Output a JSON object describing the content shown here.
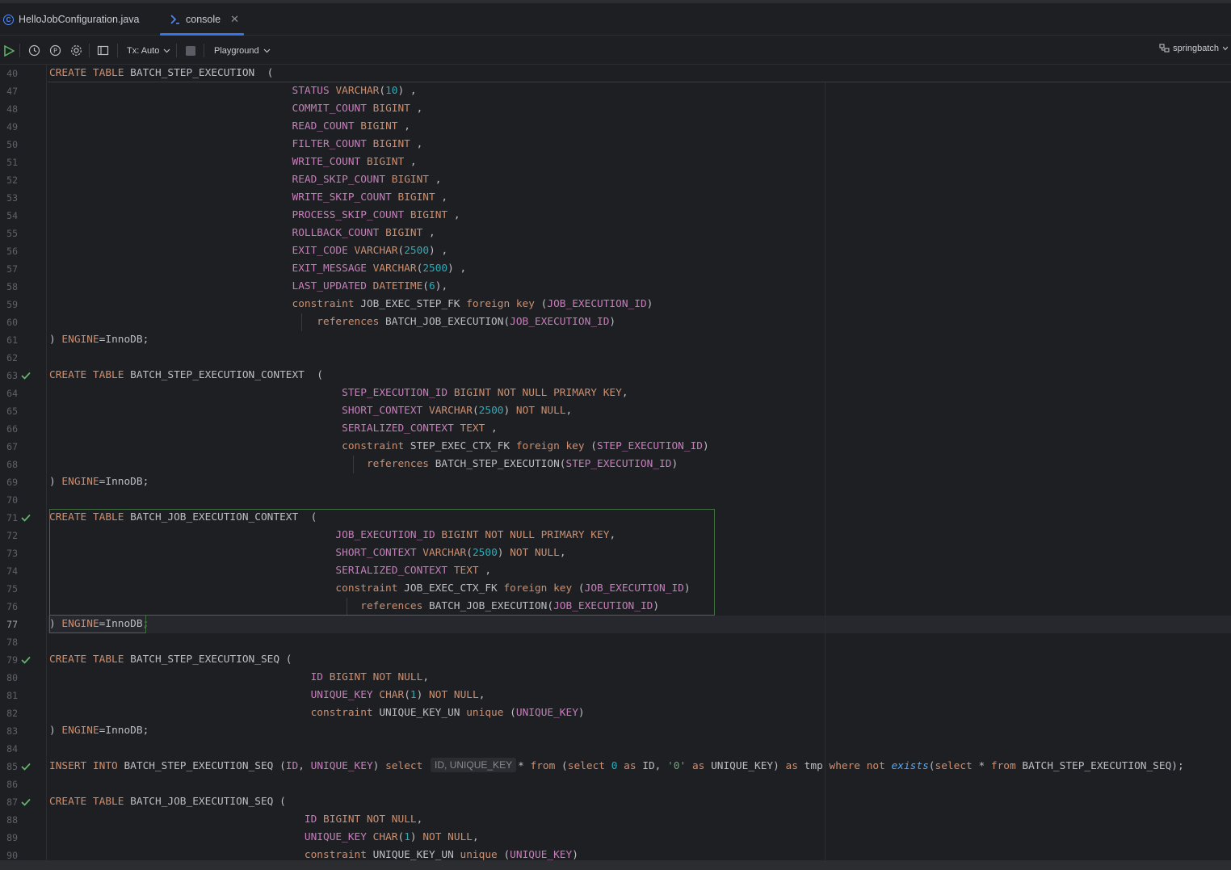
{
  "tabs": [
    {
      "label": "HelloJobConfiguration.java",
      "icon": "class-icon"
    },
    {
      "label": "console",
      "icon": "console-icon",
      "active": true
    }
  ],
  "toolbar": {
    "tx_label": "Tx: Auto",
    "playground_label": "Playground",
    "datasource_label": "springbatch"
  },
  "colors": {
    "keyword": "#cf8e6d",
    "column": "#c77dbb",
    "number": "#2aacb8",
    "string": "#6aab73",
    "function": "#56a8f5",
    "accent": "#3574f0",
    "check": "#5fb865"
  },
  "sticky_line": {
    "number": "40",
    "text": "CREATE TABLE BATCH_STEP_EXECUTION  ("
  },
  "current_line": "77",
  "lines": [
    {
      "number": "47"
    },
    {
      "number": "48"
    },
    {
      "number": "49"
    },
    {
      "number": "50"
    },
    {
      "number": "51"
    },
    {
      "number": "52"
    },
    {
      "number": "53"
    },
    {
      "number": "54"
    },
    {
      "number": "55"
    },
    {
      "number": "56"
    },
    {
      "number": "57"
    },
    {
      "number": "58"
    },
    {
      "number": "59"
    },
    {
      "number": "60"
    },
    {
      "number": "61"
    },
    {
      "number": "62"
    },
    {
      "number": "63",
      "check": true
    },
    {
      "number": "64"
    },
    {
      "number": "65"
    },
    {
      "number": "66"
    },
    {
      "number": "67"
    },
    {
      "number": "68"
    },
    {
      "number": "69"
    },
    {
      "number": "70"
    },
    {
      "number": "71",
      "check": true
    },
    {
      "number": "72"
    },
    {
      "number": "73"
    },
    {
      "number": "74"
    },
    {
      "number": "75"
    },
    {
      "number": "76"
    },
    {
      "number": "77"
    },
    {
      "number": "78"
    },
    {
      "number": "79",
      "check": true
    },
    {
      "number": "80"
    },
    {
      "number": "81"
    },
    {
      "number": "82"
    },
    {
      "number": "83"
    },
    {
      "number": "84"
    },
    {
      "number": "85",
      "check": true
    },
    {
      "number": "86"
    },
    {
      "number": "87",
      "check": true
    },
    {
      "number": "88"
    },
    {
      "number": "89"
    },
    {
      "number": "90"
    }
  ],
  "code": [
    [
      {
        "t": "                                       "
      },
      {
        "t": "STATUS",
        "c": "c"
      },
      {
        "t": " "
      },
      {
        "t": "VARCHAR",
        "c": "k"
      },
      {
        "t": "("
      },
      {
        "t": "10",
        "c": "n"
      },
      {
        "t": ") ,"
      }
    ],
    [
      {
        "t": "                                       "
      },
      {
        "t": "COMMIT_COUNT",
        "c": "c"
      },
      {
        "t": " "
      },
      {
        "t": "BIGINT",
        "c": "k"
      },
      {
        "t": " ,"
      }
    ],
    [
      {
        "t": "                                       "
      },
      {
        "t": "READ_COUNT",
        "c": "c"
      },
      {
        "t": " "
      },
      {
        "t": "BIGINT",
        "c": "k"
      },
      {
        "t": " ,"
      }
    ],
    [
      {
        "t": "                                       "
      },
      {
        "t": "FILTER_COUNT",
        "c": "c"
      },
      {
        "t": " "
      },
      {
        "t": "BIGINT",
        "c": "k"
      },
      {
        "t": " ,"
      }
    ],
    [
      {
        "t": "                                       "
      },
      {
        "t": "WRITE_COUNT",
        "c": "c"
      },
      {
        "t": " "
      },
      {
        "t": "BIGINT",
        "c": "k"
      },
      {
        "t": " ,"
      }
    ],
    [
      {
        "t": "                                       "
      },
      {
        "t": "READ_SKIP_COUNT",
        "c": "c"
      },
      {
        "t": " "
      },
      {
        "t": "BIGINT",
        "c": "k"
      },
      {
        "t": " ,"
      }
    ],
    [
      {
        "t": "                                       "
      },
      {
        "t": "WRITE_SKIP_COUNT",
        "c": "c"
      },
      {
        "t": " "
      },
      {
        "t": "BIGINT",
        "c": "k"
      },
      {
        "t": " ,"
      }
    ],
    [
      {
        "t": "                                       "
      },
      {
        "t": "PROCESS_SKIP_COUNT",
        "c": "c"
      },
      {
        "t": " "
      },
      {
        "t": "BIGINT",
        "c": "k"
      },
      {
        "t": " ,"
      }
    ],
    [
      {
        "t": "                                       "
      },
      {
        "t": "ROLLBACK_COUNT",
        "c": "c"
      },
      {
        "t": " "
      },
      {
        "t": "BIGINT",
        "c": "k"
      },
      {
        "t": " ,"
      }
    ],
    [
      {
        "t": "                                       "
      },
      {
        "t": "EXIT_CODE",
        "c": "c"
      },
      {
        "t": " "
      },
      {
        "t": "VARCHAR",
        "c": "k"
      },
      {
        "t": "("
      },
      {
        "t": "2500",
        "c": "n"
      },
      {
        "t": ") ,"
      }
    ],
    [
      {
        "t": "                                       "
      },
      {
        "t": "EXIT_MESSAGE",
        "c": "c"
      },
      {
        "t": " "
      },
      {
        "t": "VARCHAR",
        "c": "k"
      },
      {
        "t": "("
      },
      {
        "t": "2500",
        "c": "n"
      },
      {
        "t": ") ,"
      }
    ],
    [
      {
        "t": "                                       "
      },
      {
        "t": "LAST_UPDATED",
        "c": "c"
      },
      {
        "t": " "
      },
      {
        "t": "DATETIME",
        "c": "k"
      },
      {
        "t": "("
      },
      {
        "t": "6",
        "c": "n"
      },
      {
        "t": "),"
      }
    ],
    [
      {
        "t": "                                       "
      },
      {
        "t": "constraint",
        "c": "k"
      },
      {
        "t": " JOB_EXEC_STEP_FK "
      },
      {
        "t": "foreign key",
        "c": "k"
      },
      {
        "t": " ("
      },
      {
        "t": "JOB_EXECUTION_ID",
        "c": "c"
      },
      {
        "t": ")"
      }
    ],
    [
      {
        "t": "                                           "
      },
      {
        "t": "references",
        "c": "k"
      },
      {
        "t": " BATCH_JOB_EXECUTION("
      },
      {
        "t": "JOB_EXECUTION_ID",
        "c": "c"
      },
      {
        "t": ")"
      }
    ],
    [
      {
        "t": ") "
      },
      {
        "t": "ENGINE",
        "c": "k"
      },
      {
        "t": "=InnoDB;"
      }
    ],
    [],
    [
      {
        "t": "CREATE TABLE",
        "c": "k"
      },
      {
        "t": " BATCH_STEP_EXECUTION_CONTEXT  ("
      }
    ],
    [
      {
        "t": "                                               "
      },
      {
        "t": "STEP_EXECUTION_ID",
        "c": "c"
      },
      {
        "t": " "
      },
      {
        "t": "BIGINT NOT NULL PRIMARY KEY",
        "c": "k"
      },
      {
        "t": ","
      }
    ],
    [
      {
        "t": "                                               "
      },
      {
        "t": "SHORT_CONTEXT",
        "c": "c"
      },
      {
        "t": " "
      },
      {
        "t": "VARCHAR",
        "c": "k"
      },
      {
        "t": "("
      },
      {
        "t": "2500",
        "c": "n"
      },
      {
        "t": ") "
      },
      {
        "t": "NOT NULL",
        "c": "k"
      },
      {
        "t": ","
      }
    ],
    [
      {
        "t": "                                               "
      },
      {
        "t": "SERIALIZED_CONTEXT",
        "c": "c"
      },
      {
        "t": " "
      },
      {
        "t": "TEXT",
        "c": "k"
      },
      {
        "t": " ,"
      }
    ],
    [
      {
        "t": "                                               "
      },
      {
        "t": "constraint",
        "c": "k"
      },
      {
        "t": " STEP_EXEC_CTX_FK "
      },
      {
        "t": "foreign key",
        "c": "k"
      },
      {
        "t": " ("
      },
      {
        "t": "STEP_EXECUTION_ID",
        "c": "c"
      },
      {
        "t": ")"
      }
    ],
    [
      {
        "t": "                                                   "
      },
      {
        "t": "references",
        "c": "k"
      },
      {
        "t": " BATCH_STEP_EXECUTION("
      },
      {
        "t": "STEP_EXECUTION_ID",
        "c": "c"
      },
      {
        "t": ")"
      }
    ],
    [
      {
        "t": ") "
      },
      {
        "t": "ENGINE",
        "c": "k"
      },
      {
        "t": "=InnoDB;"
      }
    ],
    [],
    [
      {
        "t": "CREATE TABLE",
        "c": "k"
      },
      {
        "t": " BATCH_JOB_EXECUTION_CONTEXT  ("
      }
    ],
    [
      {
        "t": "                                              "
      },
      {
        "t": "JOB_EXECUTION_ID",
        "c": "c"
      },
      {
        "t": " "
      },
      {
        "t": "BIGINT NOT NULL PRIMARY KEY",
        "c": "k"
      },
      {
        "t": ","
      }
    ],
    [
      {
        "t": "                                              "
      },
      {
        "t": "SHORT_CONTEXT",
        "c": "c"
      },
      {
        "t": " "
      },
      {
        "t": "VARCHAR",
        "c": "k"
      },
      {
        "t": "("
      },
      {
        "t": "2500",
        "c": "n"
      },
      {
        "t": ") "
      },
      {
        "t": "NOT NULL",
        "c": "k"
      },
      {
        "t": ","
      }
    ],
    [
      {
        "t": "                                              "
      },
      {
        "t": "SERIALIZED_CONTEXT",
        "c": "c"
      },
      {
        "t": " "
      },
      {
        "t": "TEXT",
        "c": "k"
      },
      {
        "t": " ,"
      }
    ],
    [
      {
        "t": "                                              "
      },
      {
        "t": "constraint",
        "c": "k"
      },
      {
        "t": " JOB_EXEC_CTX_FK "
      },
      {
        "t": "foreign key",
        "c": "k"
      },
      {
        "t": " ("
      },
      {
        "t": "JOB_EXECUTION_ID",
        "c": "c"
      },
      {
        "t": ")"
      }
    ],
    [
      {
        "t": "                                                  "
      },
      {
        "t": "references",
        "c": "k"
      },
      {
        "t": " BATCH_JOB_EXECUTION("
      },
      {
        "t": "JOB_EXECUTION_ID",
        "c": "c"
      },
      {
        "t": ")"
      }
    ],
    [
      {
        "t": ") "
      },
      {
        "t": "ENGINE",
        "c": "k"
      },
      {
        "t": "=InnoDB;"
      }
    ],
    [],
    [
      {
        "t": "CREATE TABLE",
        "c": "k"
      },
      {
        "t": " BATCH_STEP_EXECUTION_SEQ ("
      }
    ],
    [
      {
        "t": "                                          "
      },
      {
        "t": "ID",
        "c": "c"
      },
      {
        "t": " "
      },
      {
        "t": "BIGINT NOT NULL",
        "c": "k"
      },
      {
        "t": ","
      }
    ],
    [
      {
        "t": "                                          "
      },
      {
        "t": "UNIQUE_KEY",
        "c": "c"
      },
      {
        "t": " "
      },
      {
        "t": "CHAR",
        "c": "k"
      },
      {
        "t": "("
      },
      {
        "t": "1",
        "c": "n"
      },
      {
        "t": ") "
      },
      {
        "t": "NOT NULL",
        "c": "k"
      },
      {
        "t": ","
      }
    ],
    [
      {
        "t": "                                          "
      },
      {
        "t": "constraint",
        "c": "k"
      },
      {
        "t": " UNIQUE_KEY_UN "
      },
      {
        "t": "unique",
        "c": "k"
      },
      {
        "t": " ("
      },
      {
        "t": "UNIQUE_KEY",
        "c": "c"
      },
      {
        "t": ")"
      }
    ],
    [
      {
        "t": ") "
      },
      {
        "t": "ENGINE",
        "c": "k"
      },
      {
        "t": "=InnoDB;"
      }
    ],
    [],
    [
      {
        "t": "INSERT INTO",
        "c": "k"
      },
      {
        "t": " BATCH_STEP_EXECUTION_SEQ ("
      },
      {
        "t": "ID",
        "c": "c"
      },
      {
        "t": ", "
      },
      {
        "t": "UNIQUE_KEY",
        "c": "c"
      },
      {
        "t": ") "
      },
      {
        "t": "select",
        "c": "k"
      },
      {
        "t": " "
      },
      {
        "hint": "ID, UNIQUE_KEY"
      },
      {
        "t": "* "
      },
      {
        "t": "from",
        "c": "k"
      },
      {
        "t": " ("
      },
      {
        "t": "select",
        "c": "k"
      },
      {
        "t": " "
      },
      {
        "t": "0",
        "c": "n"
      },
      {
        "t": " "
      },
      {
        "t": "as",
        "c": "k"
      },
      {
        "t": " ID, "
      },
      {
        "t": "'0'",
        "c": "s"
      },
      {
        "t": " "
      },
      {
        "t": "as",
        "c": "k"
      },
      {
        "t": " UNIQUE_KEY) "
      },
      {
        "t": "as",
        "c": "k"
      },
      {
        "t": " tmp "
      },
      {
        "t": "where not",
        "c": "k"
      },
      {
        "t": " "
      },
      {
        "t": "exists",
        "c": "f"
      },
      {
        "t": "("
      },
      {
        "t": "select",
        "c": "k"
      },
      {
        "t": " * "
      },
      {
        "t": "from",
        "c": "k"
      },
      {
        "t": " BATCH_STEP_EXECUTION_SEQ);"
      }
    ],
    [],
    [
      {
        "t": "CREATE TABLE",
        "c": "k"
      },
      {
        "t": " BATCH_JOB_EXECUTION_SEQ ("
      }
    ],
    [
      {
        "t": "                                         "
      },
      {
        "t": "ID",
        "c": "c"
      },
      {
        "t": " "
      },
      {
        "t": "BIGINT NOT NULL",
        "c": "k"
      },
      {
        "t": ","
      }
    ],
    [
      {
        "t": "                                         "
      },
      {
        "t": "UNIQUE_KEY",
        "c": "c"
      },
      {
        "t": " "
      },
      {
        "t": "CHAR",
        "c": "k"
      },
      {
        "t": "("
      },
      {
        "t": "1",
        "c": "n"
      },
      {
        "t": ") "
      },
      {
        "t": "NOT NULL",
        "c": "k"
      },
      {
        "t": ","
      }
    ],
    [
      {
        "t": "                                         "
      },
      {
        "t": "constraint",
        "c": "k"
      },
      {
        "t": " UNIQUE_KEY_UN "
      },
      {
        "t": "unique",
        "c": "k"
      },
      {
        "t": " ("
      },
      {
        "t": "UNIQUE_KEY",
        "c": "c"
      },
      {
        "t": ")"
      }
    ]
  ]
}
